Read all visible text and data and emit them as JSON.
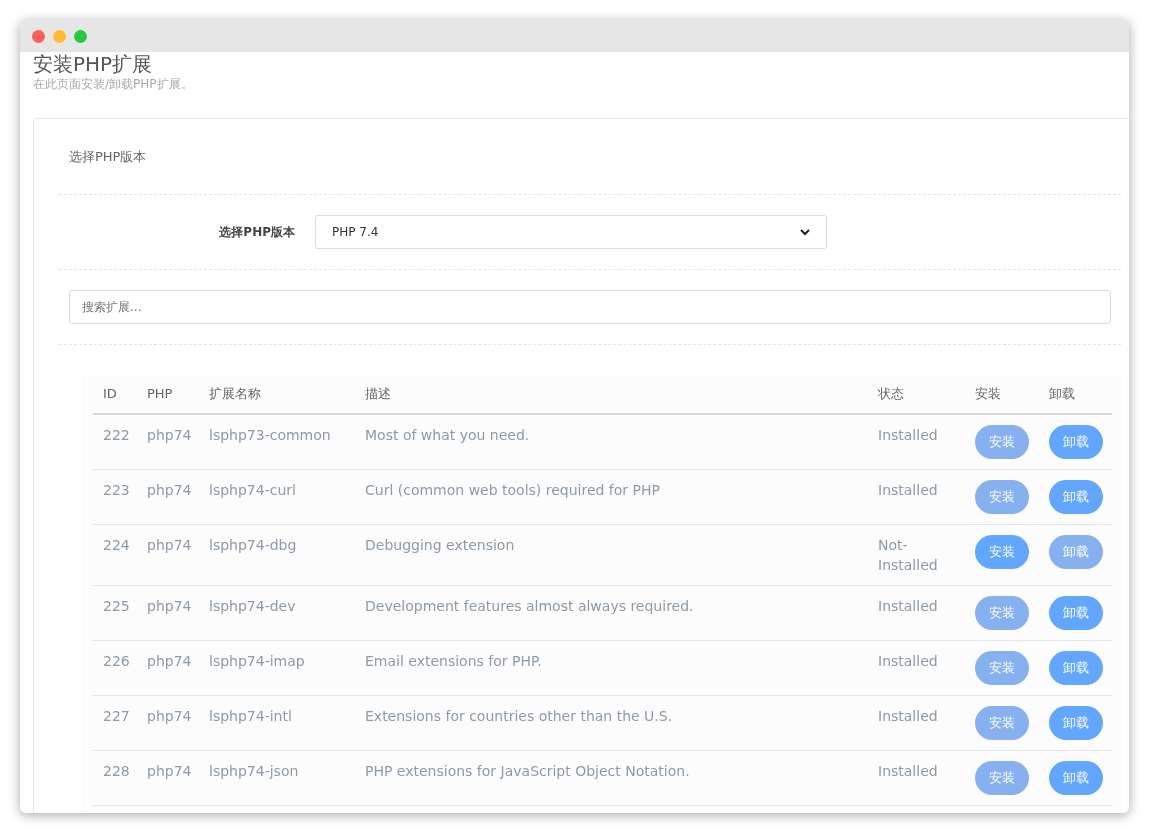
{
  "page": {
    "title": "安装PHP扩展",
    "subtitle": "在此页面安装/卸载PHP扩展。"
  },
  "card": {
    "title": "选择PHP版本",
    "version_label": "选择PHP版本",
    "version_value": "PHP 7.4",
    "search": {
      "placeholder": "搜索扩展..."
    }
  },
  "table": {
    "columns": [
      "ID",
      "PHP",
      "扩展名称",
      "描述",
      "状态",
      "安装",
      "卸载"
    ],
    "rows": [
      {
        "id": "222",
        "php": "php74",
        "name": "lsphp73-common",
        "description": "Most of what you need.",
        "status": "Installed",
        "install": {
          "label": "安装",
          "disabled": true
        },
        "uninstall": {
          "label": "卸载",
          "disabled": false
        }
      },
      {
        "id": "223",
        "php": "php74",
        "name": "lsphp74-curl",
        "description": "Curl (common web tools) required for PHP",
        "status": "Installed",
        "install": {
          "label": "安装",
          "disabled": true
        },
        "uninstall": {
          "label": "卸载",
          "disabled": false
        }
      },
      {
        "id": "224",
        "php": "php74",
        "name": "lsphp74-dbg",
        "description": "Debugging extension",
        "status": "Not-Installed",
        "install": {
          "label": "安装",
          "disabled": false
        },
        "uninstall": {
          "label": "卸载",
          "disabled": true
        }
      },
      {
        "id": "225",
        "php": "php74",
        "name": "lsphp74-dev",
        "description": "Development features almost always required.",
        "status": "Installed",
        "install": {
          "label": "安装",
          "disabled": true
        },
        "uninstall": {
          "label": "卸载",
          "disabled": false
        }
      },
      {
        "id": "226",
        "php": "php74",
        "name": "lsphp74-imap",
        "description": "Email extensions for PHP.",
        "status": "Installed",
        "install": {
          "label": "安装",
          "disabled": true
        },
        "uninstall": {
          "label": "卸载",
          "disabled": false
        }
      },
      {
        "id": "227",
        "php": "php74",
        "name": "lsphp74-intl",
        "description": "Extensions for countries other than the U.S.",
        "status": "Installed",
        "install": {
          "label": "安装",
          "disabled": true
        },
        "uninstall": {
          "label": "卸载",
          "disabled": false
        }
      },
      {
        "id": "228",
        "php": "php74",
        "name": "lsphp74-json",
        "description": "PHP extensions for JavaScript Object Notation.",
        "status": "Installed",
        "install": {
          "label": "安装",
          "disabled": true
        },
        "uninstall": {
          "label": "卸载",
          "disabled": false
        }
      }
    ]
  }
}
